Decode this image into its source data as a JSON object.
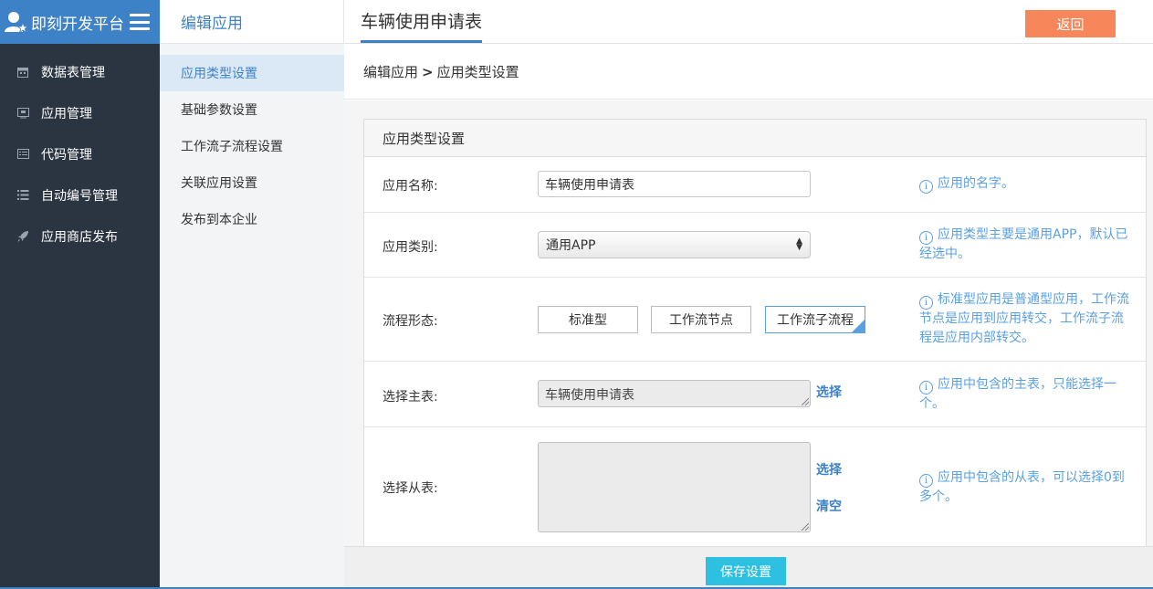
{
  "brand": {
    "title": "即刻开发平台",
    "logo_icon": "user-star-icon",
    "menu_icon": "hamburger-icon"
  },
  "nav": {
    "items": [
      {
        "label": "数据表管理",
        "icon": "calendar-icon"
      },
      {
        "label": "应用管理",
        "icon": "monitor-icon"
      },
      {
        "label": "代码管理",
        "icon": "list-box-icon"
      },
      {
        "label": "自动编号管理",
        "icon": "list-icon"
      },
      {
        "label": "应用商店发布",
        "icon": "rocket-icon"
      }
    ]
  },
  "subnav": {
    "title": "编辑应用",
    "items": [
      {
        "label": "应用类型设置",
        "active": true
      },
      {
        "label": "基础参数设置",
        "active": false
      },
      {
        "label": "工作流子流程设置",
        "active": false
      },
      {
        "label": "关联应用设置",
        "active": false
      },
      {
        "label": "发布到本企业",
        "active": false
      }
    ]
  },
  "header": {
    "title": "车辆使用申请表",
    "back_label": "返回"
  },
  "breadcrumb": {
    "parent": "编辑应用",
    "separator": ">",
    "current": "应用类型设置"
  },
  "panel": {
    "title": "应用类型设置",
    "app_name": {
      "label": "应用名称:",
      "value": "车辆使用申请表",
      "hint": "应用的名字。"
    },
    "app_category": {
      "label": "应用类别:",
      "selected": "通用APP",
      "hint": "应用类型主要是通用APP，默认已经选中。"
    },
    "flow_form": {
      "label": "流程形态:",
      "options": [
        "标准型",
        "工作流节点",
        "工作流子流程"
      ],
      "selected": "工作流子流程",
      "hint": "标准型应用是普通型应用，工作流节点是应用到应用转交，工作流子流程是应用内部转交。"
    },
    "main_table": {
      "label": "选择主表:",
      "value": "车辆使用申请表",
      "select_link": "选择",
      "hint": "应用中包含的主表，只能选择一个。"
    },
    "sub_table": {
      "label": "选择从表:",
      "value": "",
      "select_link": "选择",
      "clear_link": "清空",
      "hint": "应用中包含的从表，可以选择0到多个。"
    }
  },
  "footer": {
    "save_label": "保存设置"
  },
  "colors": {
    "sidebar": "#2b3542",
    "brand": "#3d82c7",
    "accent": "#3d82c7",
    "back": "#f7875a",
    "save": "#2ec0e0",
    "hint": "#5ba0e0"
  }
}
